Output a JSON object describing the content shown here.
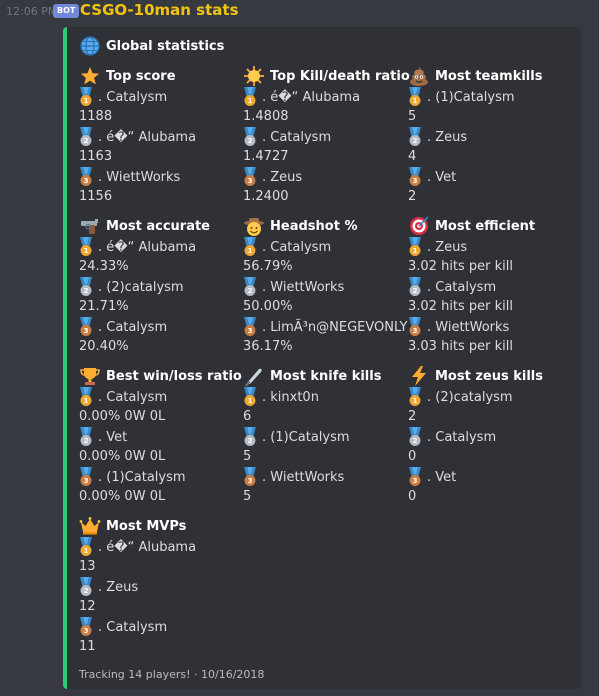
{
  "header": {
    "timestamp": "12:06 PM",
    "badge": "BOT",
    "username": "CSGO-10man stats",
    "username_color": "#f1c40f"
  },
  "embed": {
    "accent_color": "#2ecc71",
    "title": "Global statistics",
    "title_icon": "globe-icon",
    "footer": "Tracking 14 players! · 10/16/2018"
  },
  "fields": [
    {
      "key": "top-score",
      "icon": "star-icon",
      "title": "Top score",
      "entries": [
        {
          "name": ". Catalysm",
          "value": "1188"
        },
        {
          "name": ". é�“ Alubama",
          "value": "1163"
        },
        {
          "name": ". WiettWorks",
          "value": "1156"
        }
      ]
    },
    {
      "key": "top-kd",
      "icon": "sun-icon",
      "title": "Top Kill/death ratio",
      "entries": [
        {
          "name": ". é�“ Alubama",
          "value": "1.4808"
        },
        {
          "name": ". Catalysm",
          "value": "1.4727"
        },
        {
          "name": ". Zeus",
          "value": "1.2400"
        }
      ]
    },
    {
      "key": "most-teamkills",
      "icon": "poop-icon",
      "title": "Most teamkills",
      "entries": [
        {
          "name": ". (1)Catalysm",
          "value": "5"
        },
        {
          "name": ". Zeus",
          "value": "4"
        },
        {
          "name": ". Vet",
          "value": "2"
        }
      ]
    },
    {
      "key": "most-accurate",
      "icon": "gun-icon",
      "title": "Most accurate",
      "entries": [
        {
          "name": ". é�“ Alubama",
          "value": "24.33%"
        },
        {
          "name": ". (2)catalysm",
          "value": "21.71%"
        },
        {
          "name": ". Catalysm",
          "value": "20.40%"
        }
      ]
    },
    {
      "key": "headshot",
      "icon": "cowboy-icon",
      "title": "Headshot %",
      "entries": [
        {
          "name": ". Catalysm",
          "value": "56.79%"
        },
        {
          "name": ". WiettWorks",
          "value": "50.00%"
        },
        {
          "name": ". LimÃ³n@NEGEVONLY",
          "value": "36.17%"
        }
      ]
    },
    {
      "key": "most-efficient",
      "icon": "target-icon",
      "title": "Most efficient",
      "entries": [
        {
          "name": ". Zeus",
          "value": "3.02 hits per kill"
        },
        {
          "name": ". Catalysm",
          "value": "3.02 hits per kill"
        },
        {
          "name": ". WiettWorks",
          "value": "3.03 hits per kill"
        }
      ]
    },
    {
      "key": "best-wl",
      "icon": "trophy-icon",
      "title": "Best win/loss ratio",
      "entries": [
        {
          "name": ". Catalysm",
          "value": "0.00% 0W 0L"
        },
        {
          "name": ". Vet",
          "value": "0.00% 0W 0L"
        },
        {
          "name": ". (1)Catalysm",
          "value": "0.00% 0W 0L"
        }
      ]
    },
    {
      "key": "knife-kills",
      "icon": "knife-icon",
      "title": "Most knife kills",
      "entries": [
        {
          "name": ". kinxt0n",
          "value": "6"
        },
        {
          "name": ". (1)Catalysm",
          "value": "5"
        },
        {
          "name": ". WiettWorks",
          "value": "5"
        }
      ]
    },
    {
      "key": "zeus-kills",
      "icon": "lightning-icon",
      "title": "Most zeus kills",
      "entries": [
        {
          "name": ". (2)catalysm",
          "value": "2"
        },
        {
          "name": ". Catalysm",
          "value": "0"
        },
        {
          "name": ". Vet",
          "value": "0"
        }
      ]
    },
    {
      "key": "most-mvps",
      "icon": "crown-icon",
      "title": "Most MVPs",
      "entries": [
        {
          "name": ". é�“ Alubama",
          "value": "13"
        },
        {
          "name": ". Zeus",
          "value": "12"
        },
        {
          "name": ". Catalysm",
          "value": "11"
        }
      ]
    }
  ],
  "medals": {
    "first": {
      "icon": "first-place-medal-icon",
      "label": "1",
      "color": "#f0a830"
    },
    "second": {
      "icon": "second-place-medal-icon",
      "label": "2",
      "color": "#b6bcc6"
    },
    "third": {
      "icon": "third-place-medal-icon",
      "label": "3",
      "color": "#cd7f43"
    }
  }
}
